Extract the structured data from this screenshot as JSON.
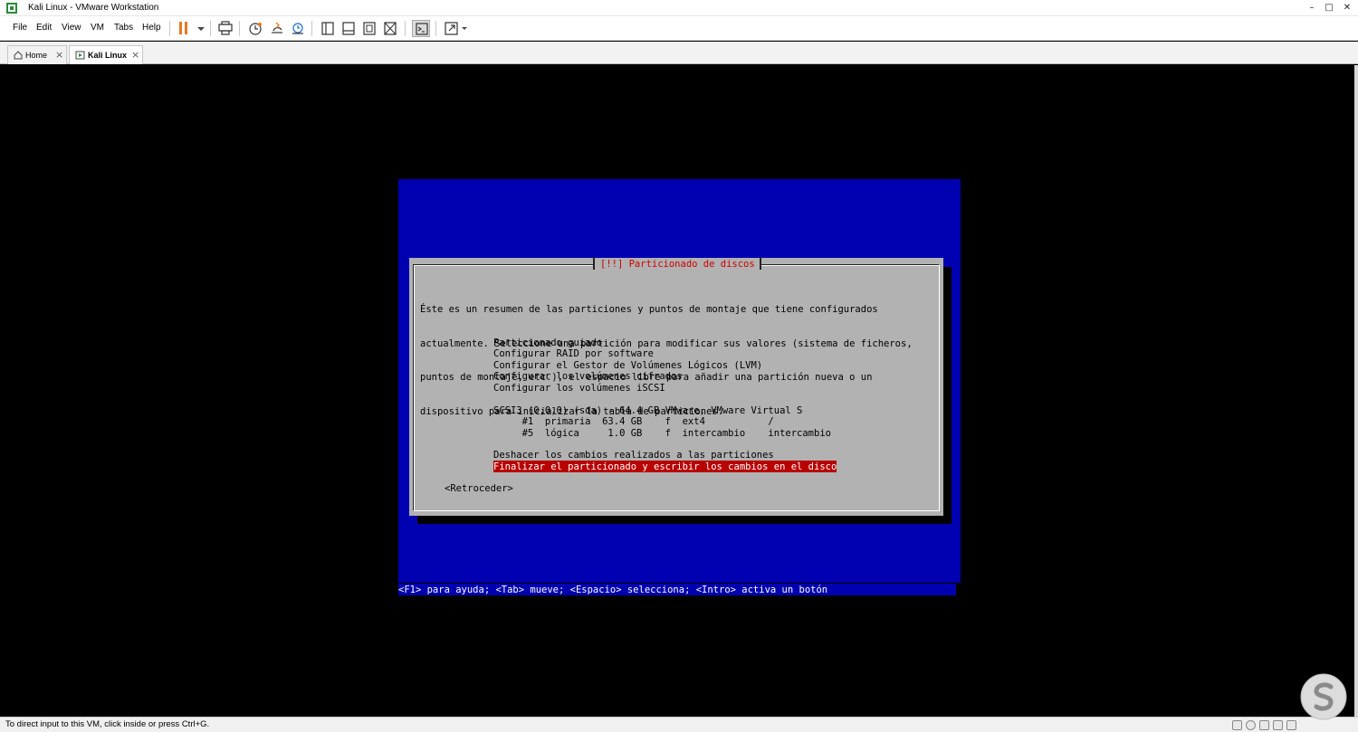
{
  "window": {
    "title": "Kali Linux - VMware Workstation"
  },
  "menu": {
    "items": [
      "File",
      "Edit",
      "View",
      "VM",
      "Tabs",
      "Help"
    ]
  },
  "toolbar": {
    "icons": [
      "pause-icon",
      "dropdown-arrow-icon",
      "send-ctrl-alt-del-icon",
      "snapshot-icon",
      "revert-snapshot-icon",
      "snapshot-manager-icon",
      "library-view-icon",
      "thumbnail-view-icon",
      "fullscreen-icon",
      "unity-icon",
      "console-icon",
      "stretch-icon"
    ]
  },
  "tabs": [
    {
      "label": "Home",
      "active": false
    },
    {
      "label": "Kali Linux",
      "active": true
    }
  ],
  "installer": {
    "title": "[!!] Particionado de discos",
    "description": [
      "Éste es un resumen de las particiones y puntos de montaje que tiene configurados",
      "actualmente. Seleccione una partición para modificar sus valores (sistema de ficheros,",
      "puntos de montaje, etc.), el espacio libre para añadir una partición nueva o un",
      "dispositivo para inicializar la tabla de particiones."
    ],
    "options": [
      "Particionado guiado",
      "Configurar RAID por software",
      "Configurar el Gestor de Volúmenes Lógicos (LVM)",
      "Configurar los volúmenes cifrados",
      "Configurar los volúmenes iSCSI"
    ],
    "disk": "SCSI3 (0,0,0) (sda) - 64.4 GB VMware, VMware Virtual S",
    "partitions": [
      "     #1  primaria  63.4 GB    f  ext4           /",
      "     #5  lógica     1.0 GB    f  intercambio    intercambio"
    ],
    "undo_option": "Deshacer los cambios realizados a las particiones",
    "selected_option": "Finalizar el particionado y escribir los cambios en el disco",
    "back_button": "<Retroceder>",
    "help_line": "<F1> para ayuda; <Tab> mueve; <Espacio> selecciona; <Intro> activa un botón"
  },
  "status": {
    "text": "To direct input to this VM, click inside or press Ctrl+G."
  },
  "colors": {
    "installer_blue": "#0000b0",
    "dialog_gray": "#b2b2b2",
    "selection_red": "#b80000",
    "title_red": "#d00000",
    "pause_orange": "#e87722"
  }
}
